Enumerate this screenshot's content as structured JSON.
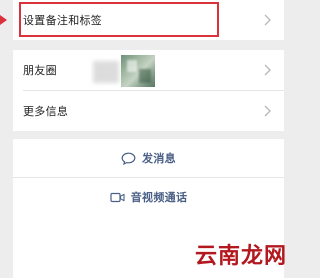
{
  "profile_menu": {
    "rows": [
      {
        "label": "设置备注和标签"
      },
      {
        "label": "朋友圈"
      },
      {
        "label": "更多信息"
      }
    ]
  },
  "actions": {
    "send_message": {
      "label": "发消息",
      "icon": "chat-bubble-icon"
    },
    "video_call": {
      "label": "音视频通话",
      "icon": "video-camera-icon"
    }
  },
  "watermark": {
    "text": "云南龙网"
  },
  "colors": {
    "highlight": "#d9323b",
    "action_text": "#4a5f86",
    "watermark": "#b3181e",
    "background": "#ededed"
  }
}
